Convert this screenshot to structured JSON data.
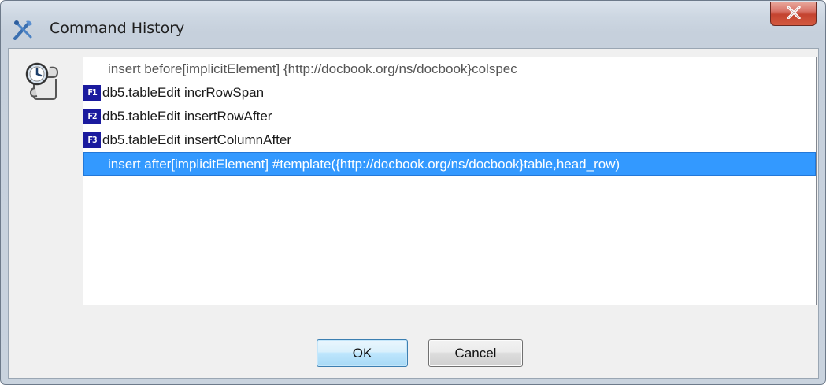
{
  "window": {
    "title": "Command History",
    "icon": "crossed-tools-icon",
    "close_icon": "close-x-icon"
  },
  "history_icon": "scroll-clock-icon",
  "commands": [
    {
      "shortcut": "",
      "label": "insert before[implicitElement] {http://docbook.org/ns/docbook}colspec",
      "style": "gray"
    },
    {
      "shortcut": "F1",
      "label": "db5.tableEdit incrRowSpan",
      "style": "normal"
    },
    {
      "shortcut": "F2",
      "label": "db5.tableEdit insertRowAfter",
      "style": "normal"
    },
    {
      "shortcut": "F3",
      "label": "db5.tableEdit insertColumnAfter",
      "style": "normal"
    },
    {
      "shortcut": "",
      "label": "insert after[implicitElement] #template({http://docbook.org/ns/docbook}table,head_row)",
      "style": "selected"
    }
  ],
  "buttons": {
    "ok_label": "OK",
    "cancel_label": "Cancel"
  },
  "colors": {
    "selection": "#3399ff",
    "shortcut_badge": "#1a1a9e",
    "close_button": "#c4432f"
  }
}
